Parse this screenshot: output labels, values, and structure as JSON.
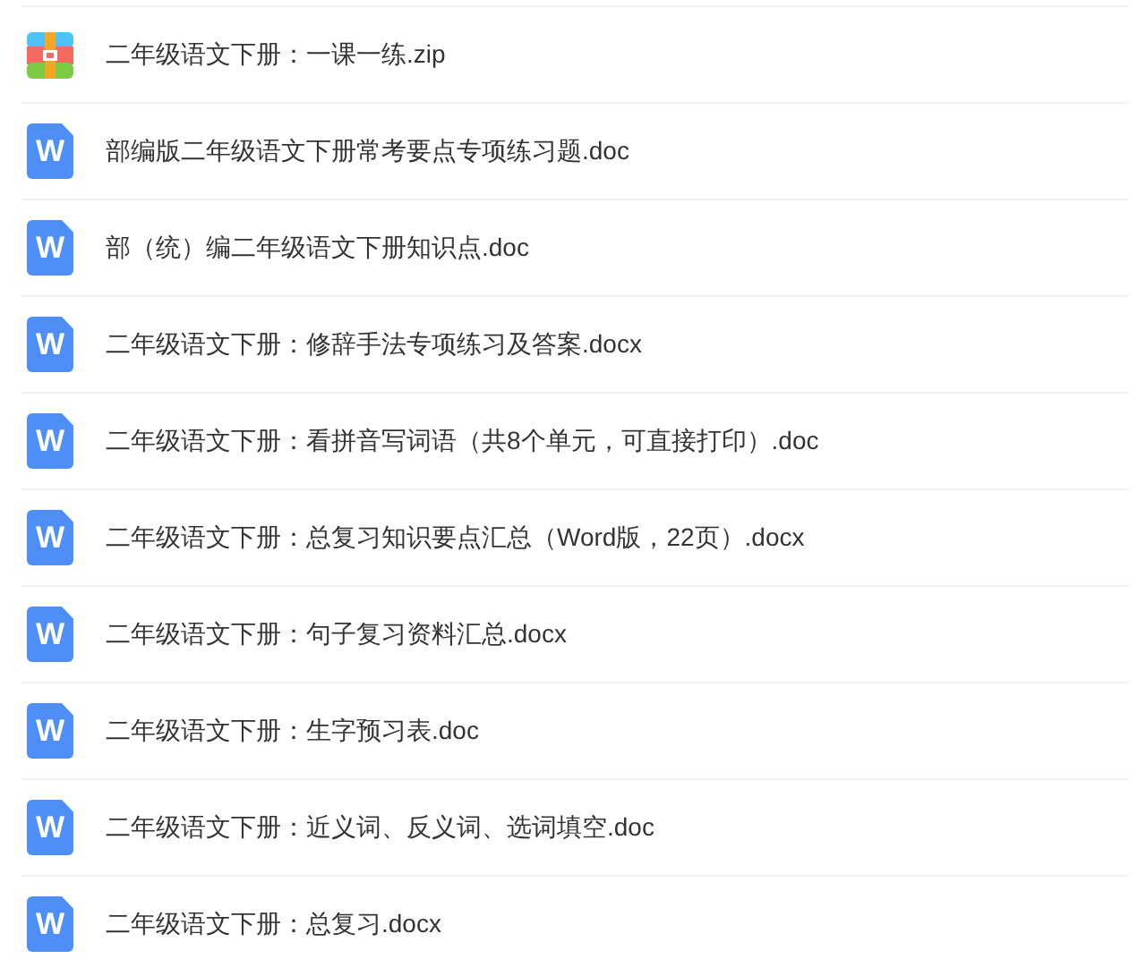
{
  "files": [
    {
      "kind": "zip",
      "name": "二年级语文下册：一课一练.zip"
    },
    {
      "kind": "word",
      "icon_letter": "W",
      "name": "部编版二年级语文下册常考要点专项练习题.doc"
    },
    {
      "kind": "word",
      "icon_letter": "W",
      "name": "部（统）编二年级语文下册知识点.doc"
    },
    {
      "kind": "word",
      "icon_letter": "W",
      "name": "二年级语文下册：修辞手法专项练习及答案.docx"
    },
    {
      "kind": "word",
      "icon_letter": "W",
      "name": "二年级语文下册：看拼音写词语（共8个单元，可直接打印）.doc"
    },
    {
      "kind": "word",
      "icon_letter": "W",
      "name": "二年级语文下册：总复习知识要点汇总（Word版，22页）.docx"
    },
    {
      "kind": "word",
      "icon_letter": "W",
      "name": "二年级语文下册：句子复习资料汇总.docx"
    },
    {
      "kind": "word",
      "icon_letter": "W",
      "name": "二年级语文下册：生字预习表.doc"
    },
    {
      "kind": "word",
      "icon_letter": "W",
      "name": "二年级语文下册：近义词、反义词、选词填空.doc"
    },
    {
      "kind": "word",
      "icon_letter": "W",
      "name": "二年级语文下册：总复习.docx"
    }
  ]
}
